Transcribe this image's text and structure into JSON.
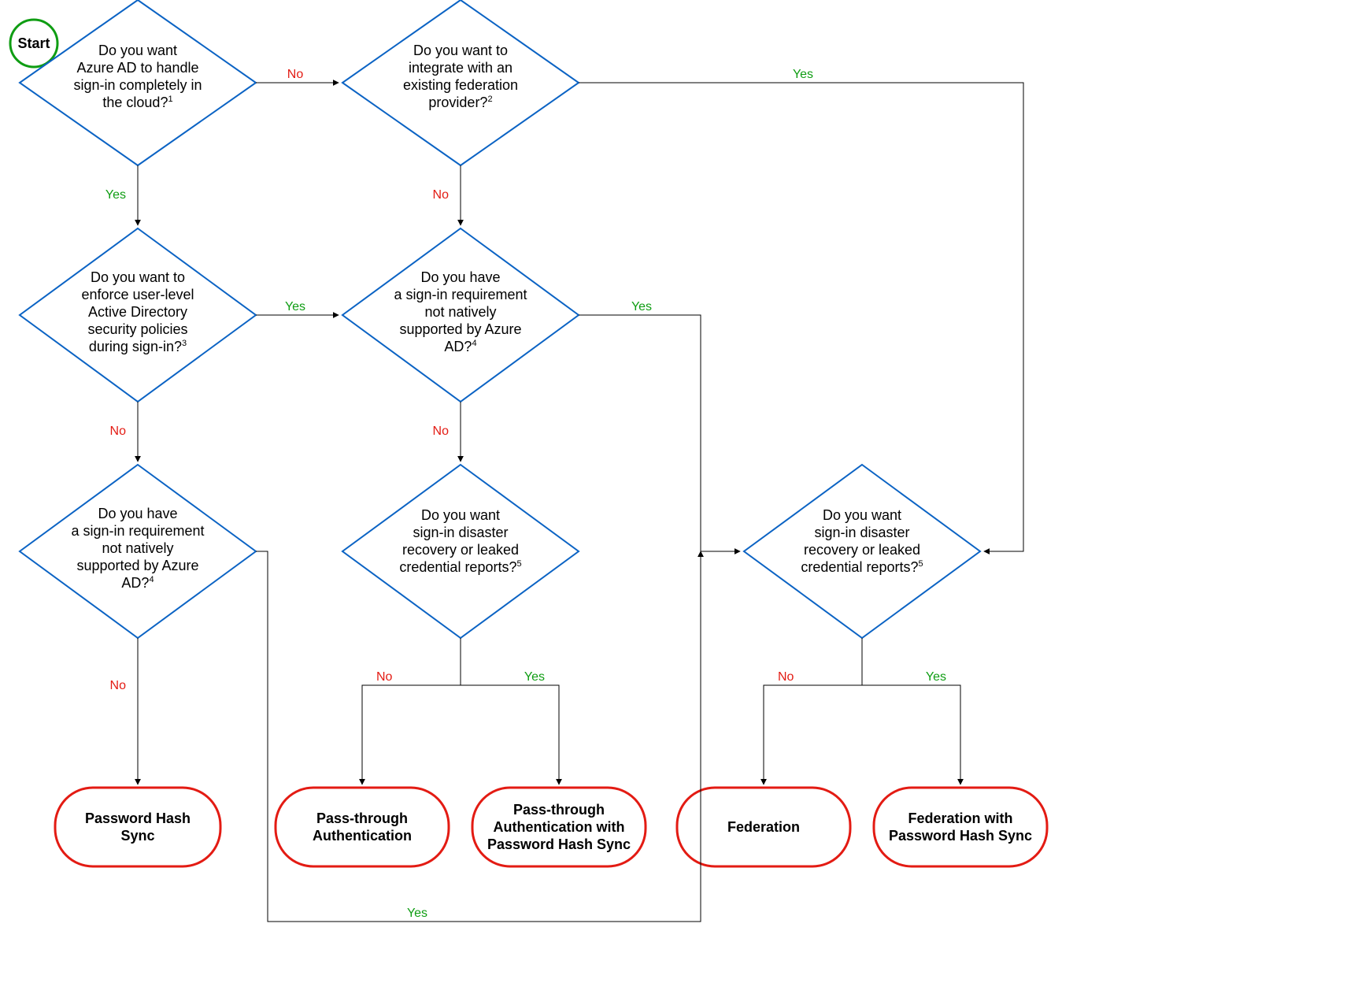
{
  "start": "Start",
  "yes": "Yes",
  "no": "No",
  "d1": {
    "l1": "Do you want",
    "l2": "Azure AD to handle",
    "l3": "sign-in completely in",
    "l4": "the cloud?",
    "sup": "1"
  },
  "d2": {
    "l1": "Do you want to",
    "l2": "integrate with an",
    "l3": "existing federation",
    "l4": "provider?",
    "sup": "2"
  },
  "d3": {
    "l1": "Do you want to",
    "l2": "enforce user-level",
    "l3": "Active Directory",
    "l4": "security policies",
    "l5": "during sign-in?",
    "sup": "3"
  },
  "d4": {
    "l1": "Do you have",
    "l2": "a sign-in requirement",
    "l3": "not natively",
    "l4": "supported by Azure",
    "l5": "AD?",
    "sup": "4"
  },
  "d5": {
    "l1": "Do you have",
    "l2": "a sign-in requirement",
    "l3": "not natively",
    "l4": "supported by Azure",
    "l5": "AD?",
    "sup": "4"
  },
  "d6": {
    "l1": "Do you want",
    "l2": "sign-in disaster",
    "l3": "recovery or leaked",
    "l4": "credential reports?",
    "sup": "5"
  },
  "d7": {
    "l1": "Do you want",
    "l2": "sign-in disaster",
    "l3": "recovery or leaked",
    "l4": "credential reports?",
    "sup": "5"
  },
  "t1": {
    "l1": "Password Hash",
    "l2": "Sync"
  },
  "t2": {
    "l1": "Pass-through",
    "l2": "Authentication"
  },
  "t3": {
    "l1": "Pass-through",
    "l2": "Authentication with",
    "l3": "Password Hash Sync"
  },
  "t4": {
    "l1": "Federation"
  },
  "t5": {
    "l1": "Federation with",
    "l2": "Password Hash Sync"
  }
}
